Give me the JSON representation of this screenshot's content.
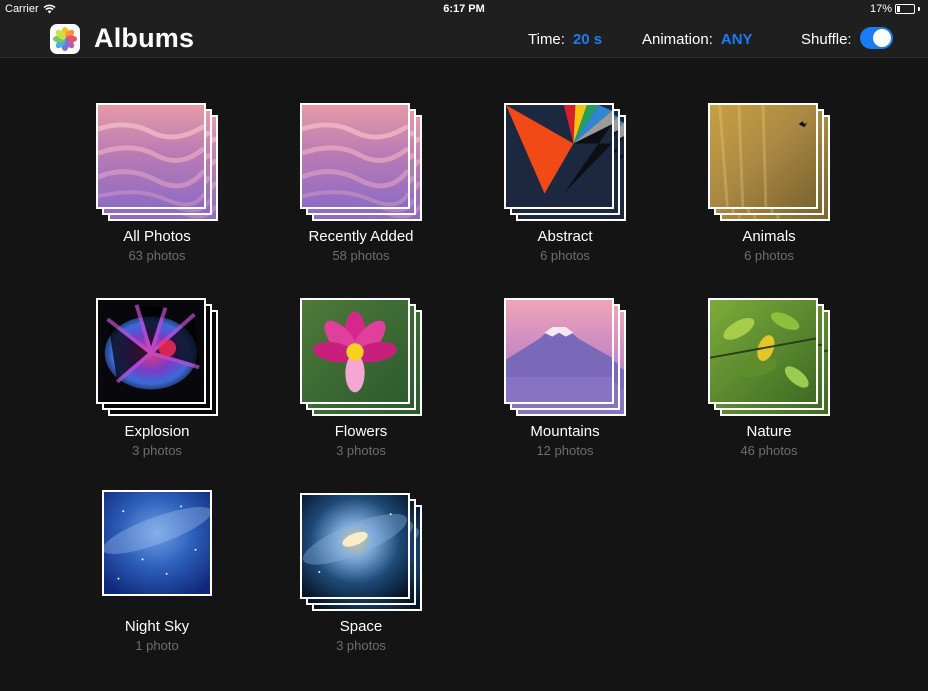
{
  "status_bar": {
    "carrier": "Carrier",
    "time": "6:17 PM",
    "battery": "17%"
  },
  "nav": {
    "title": "Albums",
    "time_label": "Time:",
    "time_value": "20 s",
    "animation_label": "Animation:",
    "animation_value": "ANY",
    "shuffle_label": "Shuffle:",
    "shuffle_on": true
  },
  "colors": {
    "accent": "#1a7cf5",
    "background": "#141414",
    "bar": "#1f1f1f",
    "subtext": "#6d6d6d"
  },
  "albums": [
    {
      "name": "All Photos",
      "count": "63 photos",
      "thumb": "pink-dunes"
    },
    {
      "name": "Recently Added",
      "count": "58 photos",
      "thumb": "pink-dunes"
    },
    {
      "name": "Abstract",
      "count": "6 photos",
      "thumb": "abstract-rays"
    },
    {
      "name": "Animals",
      "count": "6 photos",
      "thumb": "golden-mist-bird"
    },
    {
      "name": "Explosion",
      "count": "3 photos",
      "thumb": "color-explosion"
    },
    {
      "name": "Flowers",
      "count": "3 photos",
      "thumb": "pink-lotus"
    },
    {
      "name": "Mountains",
      "count": "12 photos",
      "thumb": "mount-fuji-dusk"
    },
    {
      "name": "Nature",
      "count": "46 photos",
      "thumb": "green-leaves"
    },
    {
      "name": "Night Sky",
      "count": "1 photo",
      "thumb": "milky-way"
    },
    {
      "name": "Space",
      "count": "3 photos",
      "thumb": "galaxy"
    }
  ]
}
